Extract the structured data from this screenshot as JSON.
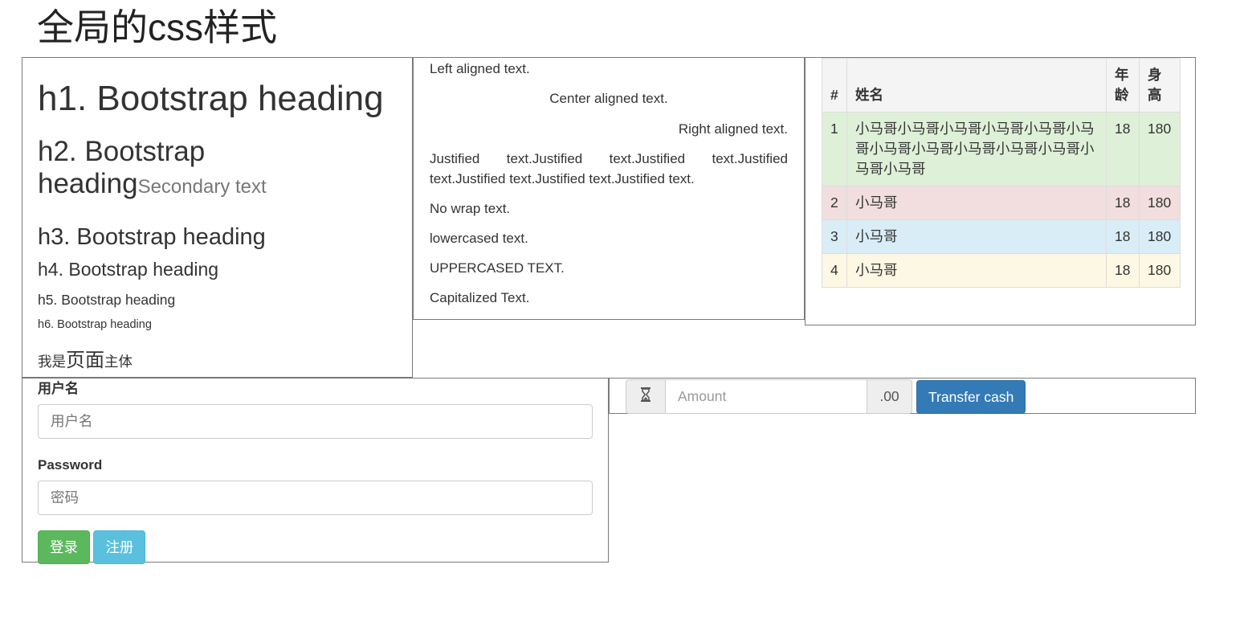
{
  "page_title": "全局的css样式",
  "headings": {
    "h1": "h1. Bootstrap heading",
    "h2": "h2. Bootstrap heading",
    "h2_small": "Secondary text",
    "h3": "h3. Bootstrap heading",
    "h4": "h4. Bootstrap heading",
    "h5": "h5. Bootstrap heading",
    "h6": "h6. Bootstrap heading",
    "body_pre": "我是",
    "body_big": "页面",
    "body_post": "主体"
  },
  "alignment": {
    "left": "Left aligned text.",
    "center": "Center aligned text.",
    "right": "Right aligned text.",
    "justified": "Justified text.Justified text.Justified text.Justified text.Justified text.Justified text.Justified text.",
    "nowrap": "No wrap text.",
    "lowercase": "lowercased text.",
    "uppercase": "UPPERCASED TEXT.",
    "capitalized": "Capitalized Text."
  },
  "table": {
    "headers": [
      "#",
      "姓名",
      "年龄",
      "身高"
    ],
    "rows": [
      {
        "num": "1",
        "name": "小马哥小马哥小马哥小马哥小马哥小马哥小马哥小马哥小马哥小马哥小马哥小马哥小马哥",
        "age": "18",
        "height": "180",
        "state": "success"
      },
      {
        "num": "2",
        "name": "小马哥",
        "age": "18",
        "height": "180",
        "state": "danger"
      },
      {
        "num": "3",
        "name": "小马哥",
        "age": "18",
        "height": "180",
        "state": "info"
      },
      {
        "num": "4",
        "name": "小马哥",
        "age": "18",
        "height": "180",
        "state": "warning"
      }
    ]
  },
  "form": {
    "username_label": "用户名",
    "username_placeholder": "用户名",
    "password_label": "Password",
    "password_placeholder": "密码",
    "login_button": "登录",
    "register_button": "注册"
  },
  "transfer": {
    "prefix_icon": "hourglass-icon",
    "amount_placeholder": "Amount",
    "suffix": ".00",
    "button": "Transfer cash"
  },
  "colors": {
    "success": "#5cb85c",
    "info": "#5bc0de",
    "primary": "#337ab7",
    "row_success": "#dff0d8",
    "row_danger": "#f2dede",
    "row_info": "#d9edf7",
    "row_warning": "#fcf8e3"
  }
}
